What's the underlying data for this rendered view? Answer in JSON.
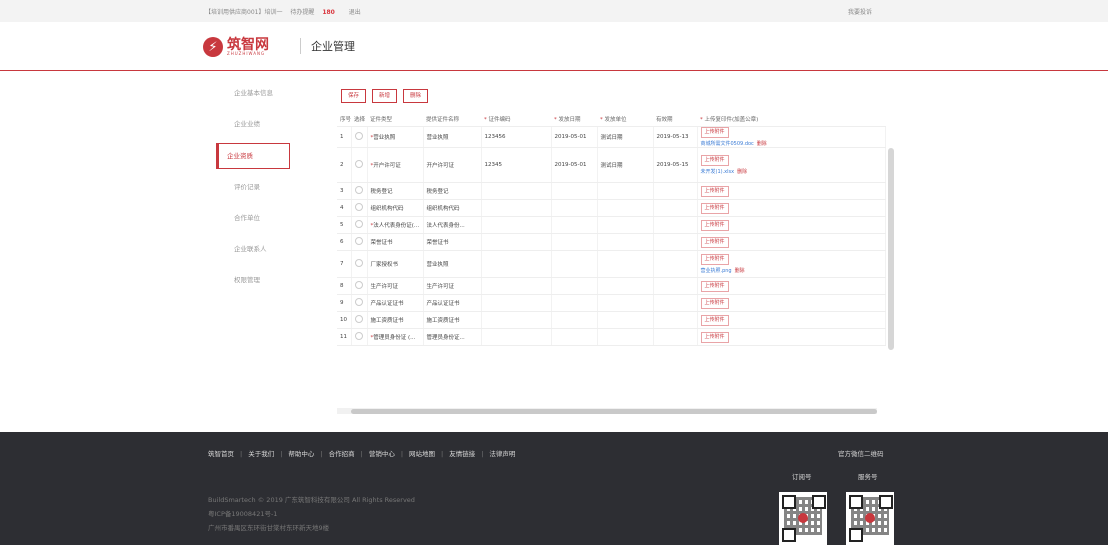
{
  "topbar": {
    "account": "【培训用供应商001】培训一",
    "pending_label": "待办提醒",
    "pending_count": "180",
    "logout": "退出",
    "complaint": "我要投诉"
  },
  "header": {
    "logo_cn": "筑智网",
    "logo_en": "ZHUZHIWANG",
    "title": "企业管理"
  },
  "sidebar": {
    "items": [
      {
        "label": "企业基本信息"
      },
      {
        "label": "企业业绩"
      },
      {
        "label": "企业资质"
      },
      {
        "label": "评价记录"
      },
      {
        "label": "合作单位"
      },
      {
        "label": "企业联系人"
      },
      {
        "label": "权限管理"
      }
    ]
  },
  "toolbar": {
    "save": "保存",
    "add": "新增",
    "delete": "删除"
  },
  "table": {
    "headers": {
      "idx": "序号",
      "select": "选择",
      "cert_type": "证件类型",
      "cert_name": "提供证件名称",
      "cert_no": "证件编码",
      "issue_date": "发放日期",
      "issuer": "发放单位",
      "valid": "有效期",
      "upload": "上传复印件(加盖公章)"
    },
    "upload_label": "上传附件",
    "delete_label": "删除",
    "rows": [
      {
        "idx": "1",
        "type": "营业执照",
        "name": "营业执照",
        "no": "123456",
        "date": "2019-05-01",
        "issuer": "测试日期",
        "valid": "2019-05-13",
        "file": "商城所需文件0509.doc"
      },
      {
        "idx": "2",
        "type": "开户许可证",
        "name": "开户许可证",
        "no": "12345",
        "date": "2019-05-01",
        "issuer": "测试日期",
        "valid": "2019-05-15",
        "file": "未开发(1).xlsx"
      },
      {
        "idx": "3",
        "type": "税务登记",
        "name": "税务登记",
        "no": "",
        "date": "",
        "issuer": "",
        "valid": "",
        "file": ""
      },
      {
        "idx": "4",
        "type": "组织机构代码",
        "name": "组织机构代码",
        "no": "",
        "date": "",
        "issuer": "",
        "valid": "",
        "file": ""
      },
      {
        "idx": "5",
        "type": "法人代表身份证(...",
        "name": "法人代表身份...",
        "no": "",
        "date": "",
        "issuer": "",
        "valid": "",
        "file": ""
      },
      {
        "idx": "6",
        "type": "荣誉证书",
        "name": "荣誉证书",
        "no": "",
        "date": "",
        "issuer": "",
        "valid": "",
        "file": ""
      },
      {
        "idx": "7",
        "type": "厂家授权书",
        "name": "营业执照",
        "no": "",
        "date": "",
        "issuer": "",
        "valid": "",
        "file": "营业执照.png"
      },
      {
        "idx": "8",
        "type": "生产许可证",
        "name": "生产许可证",
        "no": "",
        "date": "",
        "issuer": "",
        "valid": "",
        "file": ""
      },
      {
        "idx": "9",
        "type": "产品认证证书",
        "name": "产品认证证书",
        "no": "",
        "date": "",
        "issuer": "",
        "valid": "",
        "file": ""
      },
      {
        "idx": "10",
        "type": "施工资质证书",
        "name": "施工资质证书",
        "no": "",
        "date": "",
        "issuer": "",
        "valid": "",
        "file": ""
      },
      {
        "idx": "11",
        "type": "管理员身份证 (...",
        "name": "管理员身份证...",
        "no": "",
        "date": "",
        "issuer": "",
        "valid": "",
        "file": ""
      }
    ]
  },
  "footer": {
    "links": [
      "筑智首页",
      "关于我们",
      "帮助中心",
      "合作招商",
      "营销中心",
      "网站地图",
      "友情链接",
      "法律声明"
    ],
    "copyright": "BuildSmartech © 2019 广东筑智科技有限公司 All Rights Reserved",
    "icp": "粤ICP备19008421号-1",
    "address": "广州市番禺区东环街甘棠村东环新天地9楼",
    "qr_title": "官方微信二维码",
    "qr1_label": "订阅号",
    "qr2_label": "服务号"
  },
  "colors": {
    "accent": "#c8383e",
    "footer_bg": "#2d2e33",
    "link": "#3a7bd5"
  }
}
